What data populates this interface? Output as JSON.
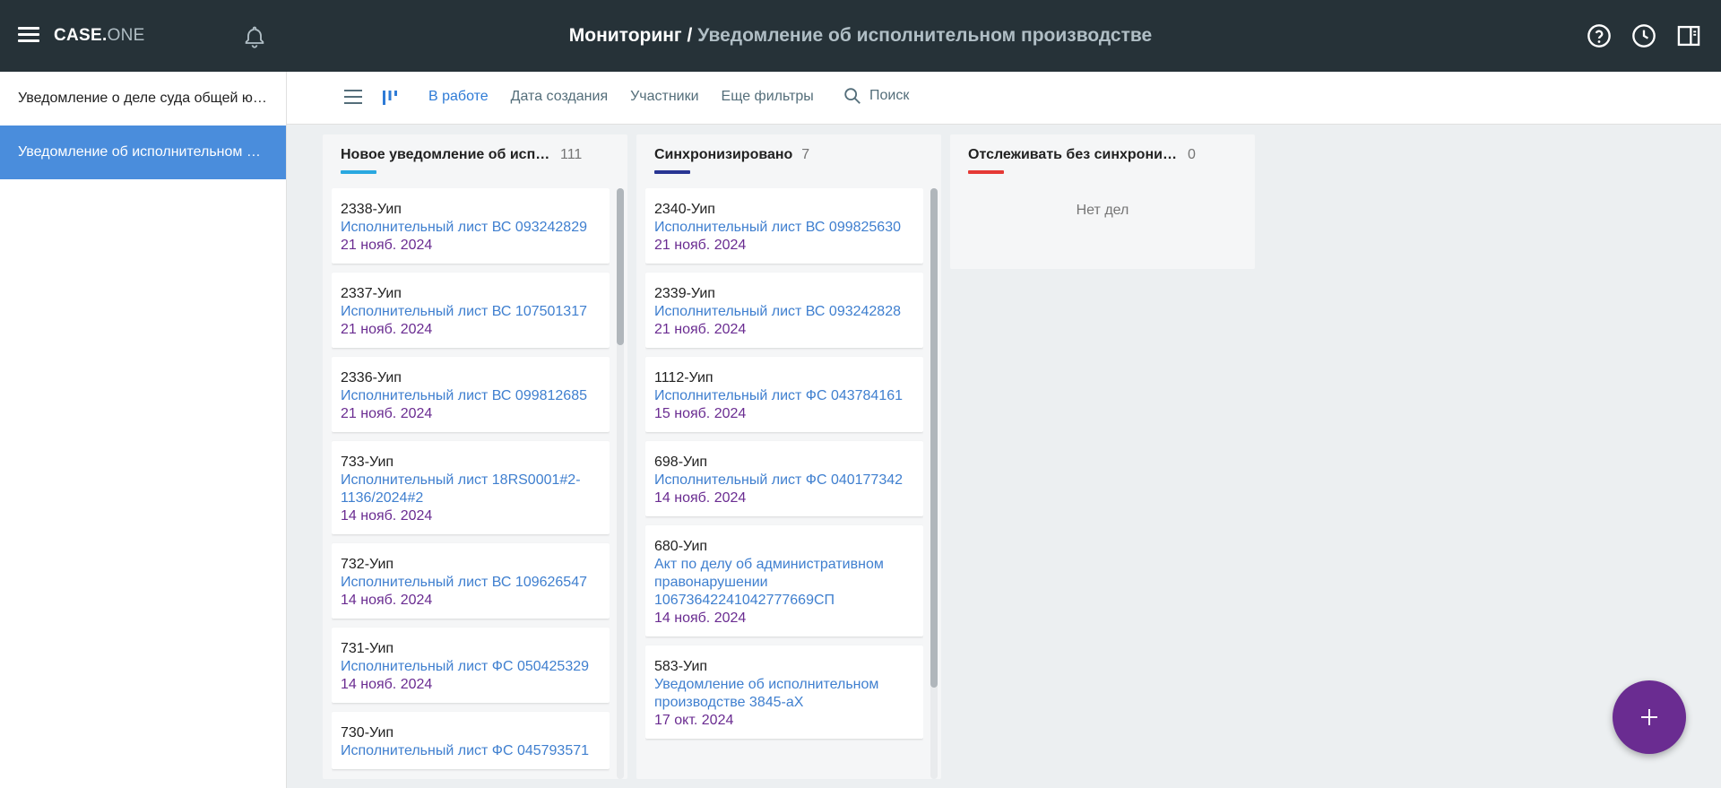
{
  "header": {
    "logo_bold": "CASE.",
    "logo_light": "ONE",
    "title_main": "Мониторинг",
    "title_sep": " / ",
    "title_sub": "Уведомление об исполнительном производстве",
    "icons": [
      "menu-icon",
      "bell-icon",
      "help-icon",
      "clock-icon",
      "panel-icon"
    ]
  },
  "sidebar": {
    "items": [
      {
        "label": "Уведомление о деле суда общей юрисдикции",
        "active": false
      },
      {
        "label": "Уведомление об исполнительном производстве",
        "active": true
      }
    ]
  },
  "toolbar": {
    "filters": [
      "В работе",
      "Дата создания",
      "Участники",
      "Еще фильтры"
    ],
    "active_filter": "В работе",
    "search_label": "Поиск"
  },
  "columns": [
    {
      "title": "Новое уведомление об исполнительном производстве",
      "count": "111",
      "color": "#29a8e0",
      "cards": [
        {
          "code": "2338-Уип",
          "link": "Исполнительный лист ВС 093242829",
          "date": "21 нояб. 2024"
        },
        {
          "code": "2337-Уип",
          "link": "Исполнительный лист ВС 107501317",
          "date": "21 нояб. 2024"
        },
        {
          "code": "2336-Уип",
          "link": "Исполнительный лист ВС 099812685",
          "date": "21 нояб. 2024"
        },
        {
          "code": "733-Уип",
          "link": "Исполнительный лист 18RS0001#2-1136/2024#2",
          "date": "14 нояб. 2024"
        },
        {
          "code": "732-Уип",
          "link": "Исполнительный лист ВС 109626547",
          "date": "14 нояб. 2024"
        },
        {
          "code": "731-Уип",
          "link": "Исполнительный лист ФС 050425329",
          "date": "14 нояб. 2024"
        },
        {
          "code": "730-Уип",
          "link": "Исполнительный лист ФС 045793571",
          "date": ""
        }
      ]
    },
    {
      "title": "Синхронизировано",
      "count": "7",
      "color": "#283593",
      "cards": [
        {
          "code": "2340-Уип",
          "link": "Исполнительный лист ВС 099825630",
          "date": "21 нояб. 2024"
        },
        {
          "code": "2339-Уип",
          "link": "Исполнительный лист ВС 093242828",
          "date": "21 нояб. 2024"
        },
        {
          "code": "1112-Уип",
          "link": "Исполнительный лист ФС 043784161",
          "date": "15 нояб. 2024"
        },
        {
          "code": "698-Уип",
          "link": "Исполнительный лист ФС 040177342",
          "date": "14 нояб. 2024"
        },
        {
          "code": "680-Уип",
          "link": "Акт по делу об административном правонарушении 10673642241042777669СП",
          "date": "14 нояб. 2024"
        },
        {
          "code": "583-Уип",
          "link": "Уведомление об исполнительном производстве 3845-аХ",
          "date": "17 окт. 2024"
        }
      ]
    },
    {
      "title": "Отслеживать без синхронизации",
      "count": "0",
      "color": "#e53935",
      "empty_label": "Нет дел",
      "cards": []
    }
  ]
}
